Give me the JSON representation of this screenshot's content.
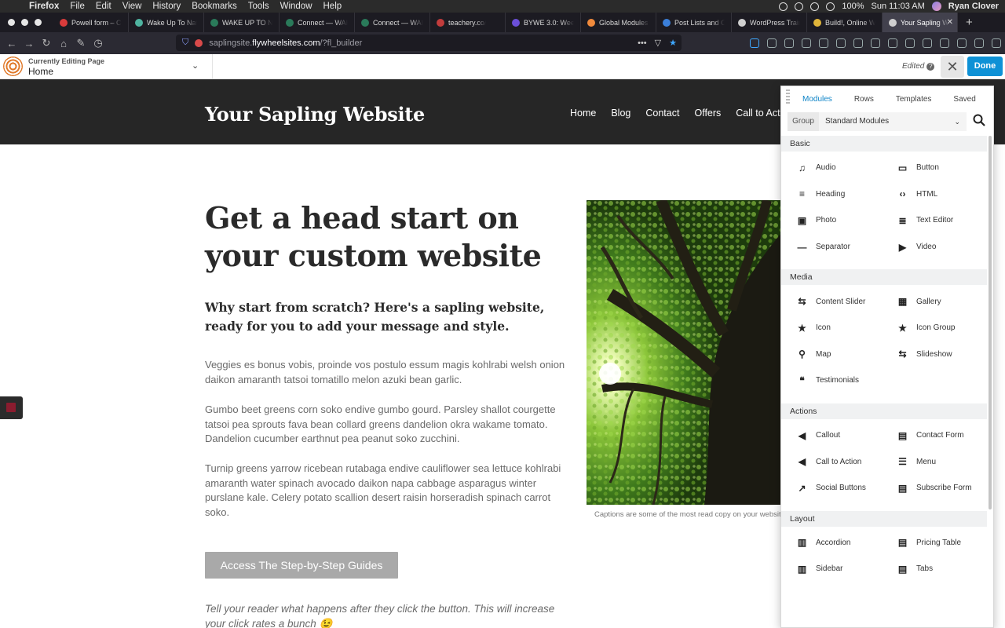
{
  "os_menubar": {
    "app_name": "Firefox",
    "menus": [
      "File",
      "Edit",
      "View",
      "History",
      "Bookmarks",
      "Tools",
      "Window",
      "Help"
    ],
    "battery": "100%",
    "clock": "Sun 11:03 AM",
    "user": "Ryan Clover"
  },
  "browser": {
    "tabs": [
      {
        "label": "Powell form – Co",
        "color": "#d93b3b"
      },
      {
        "label": "Wake Up To Natu",
        "color": "#4fb3a0"
      },
      {
        "label": "WAKE UP TO NAT",
        "color": "#2a7a5a"
      },
      {
        "label": "Connect — WAKE",
        "color": "#2a7a5a"
      },
      {
        "label": "Connect — WAKE",
        "color": "#2a7a5a"
      },
      {
        "label": "teachery.co/",
        "color": "#c23c3c"
      },
      {
        "label": "BYWE 3.0: Week",
        "color": "#6b4fd8"
      },
      {
        "label": "Global Modules a",
        "color": "#f08a3c"
      },
      {
        "label": "Post Lists and Co",
        "color": "#3b7fd9"
      },
      {
        "label": "WordPress Trainin",
        "color": "#cfcfcf"
      },
      {
        "label": "Build!, Online We",
        "color": "#e0b53a"
      },
      {
        "label": "Your Sapling W",
        "color": "#cfcfcf",
        "active": true
      }
    ],
    "url_host_dim": "saplingsite.",
    "url_host": "flywheelsites.com",
    "url_path": "/?fl_builder"
  },
  "builder_bar": {
    "editing_label": "Currently Editing Page",
    "page_name": "Home",
    "status": "Edited",
    "help": "?",
    "close": "✕",
    "done_label": "Done"
  },
  "site": {
    "title": "Your Sapling Website",
    "nav": [
      "Home",
      "Blog",
      "Contact",
      "Offers",
      "Call to Acti"
    ]
  },
  "page": {
    "heading": "Get a head start on your custom website",
    "subheading": "Why start from scratch? Here's a sapling website, ready for you to add your message and style.",
    "para1": "Veggies es bonus vobis, proinde vos postulo essum magis kohlrabi welsh onion daikon amaranth tatsoi tomatillo melon azuki bean garlic.",
    "para2": "Gumbo beet greens corn soko endive gumbo gourd. Parsley shallot courgette tatsoi pea sprouts fava bean collard greens dandelion okra wakame tomato. Dandelion cucumber earthnut pea peanut soko zucchini.",
    "para3": "Turnip greens yarrow ricebean rutabaga endive cauliflower sea lettuce kohlrabi amaranth water spinach avocado daikon napa cabbage asparagus winter purslane kale. Celery potato scallion desert raisin horseradish spinach carrot soko.",
    "button_label": "Access The Step-by-Step Guides",
    "note": "Tell your reader what happens after they click the button. This will increase your click rates a bunch 😉",
    "caption": "Captions are some of the most read copy on your website"
  },
  "panel": {
    "tabs": [
      "Modules",
      "Rows",
      "Templates",
      "Saved"
    ],
    "group_label": "Group",
    "group_value": "Standard Modules",
    "sections": [
      {
        "name": "Basic",
        "modules": [
          {
            "label": "Audio",
            "icon": "music-icon"
          },
          {
            "label": "Button",
            "icon": "button-icon"
          },
          {
            "label": "Heading",
            "icon": "heading-icon"
          },
          {
            "label": "HTML",
            "icon": "code-icon"
          },
          {
            "label": "Photo",
            "icon": "photo-icon"
          },
          {
            "label": "Text Editor",
            "icon": "text-icon"
          },
          {
            "label": "Separator",
            "icon": "separator-icon"
          },
          {
            "label": "Video",
            "icon": "video-icon"
          }
        ]
      },
      {
        "name": "Media",
        "modules": [
          {
            "label": "Content Slider",
            "icon": "slider-icon"
          },
          {
            "label": "Gallery",
            "icon": "gallery-icon"
          },
          {
            "label": "Icon",
            "icon": "star-icon"
          },
          {
            "label": "Icon Group",
            "icon": "star-icon"
          },
          {
            "label": "Map",
            "icon": "map-pin-icon"
          },
          {
            "label": "Slideshow",
            "icon": "slider-icon"
          },
          {
            "label": "Testimonials",
            "icon": "quote-icon"
          }
        ]
      },
      {
        "name": "Actions",
        "modules": [
          {
            "label": "Callout",
            "icon": "megaphone-icon"
          },
          {
            "label": "Contact Form",
            "icon": "form-icon"
          },
          {
            "label": "Call to Action",
            "icon": "megaphone-icon"
          },
          {
            "label": "Menu",
            "icon": "menu-icon"
          },
          {
            "label": "Social Buttons",
            "icon": "share-icon"
          },
          {
            "label": "Subscribe Form",
            "icon": "form-icon"
          }
        ]
      },
      {
        "name": "Layout",
        "modules": [
          {
            "label": "Accordion",
            "icon": "accordion-icon"
          },
          {
            "label": "Pricing Table",
            "icon": "form-icon"
          },
          {
            "label": "Sidebar",
            "icon": "sidebar-icon"
          },
          {
            "label": "Tabs",
            "icon": "tabs-icon"
          }
        ]
      }
    ]
  }
}
